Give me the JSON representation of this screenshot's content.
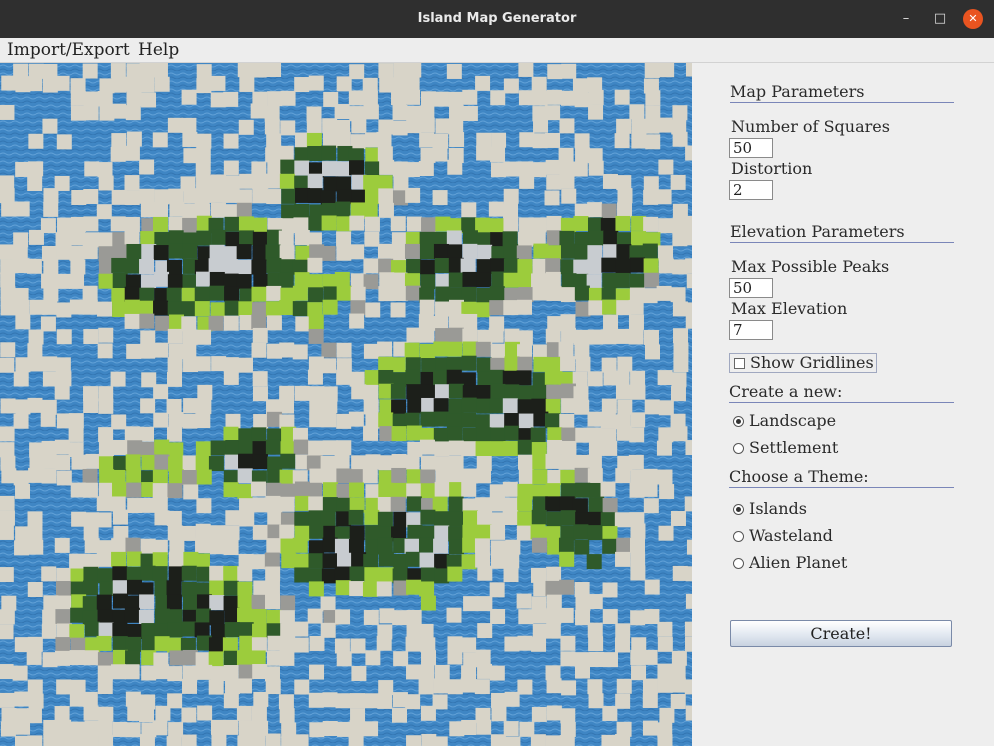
{
  "window": {
    "title": "Island Map Generator"
  },
  "menu": [
    "Import/Export",
    "Help"
  ],
  "map": {
    "water_color": "#3f86c4",
    "legend_colors": {
      "sand": "#d8d4c8",
      "rock": "#9a9a96",
      "grass": "#9ccc3c",
      "forest": "#2f5a2a",
      "peak": "#1c1f1a",
      "snow": "#c8ccd0"
    }
  },
  "panel": {
    "map_params_title": "Map Parameters",
    "squares_label": "Number of Squares",
    "squares_value": "50",
    "distortion_label": "Distortion",
    "distortion_value": "2",
    "elev_params_title": "Elevation Parameters",
    "peaks_label": "Max Possible Peaks",
    "peaks_value": "50",
    "max_elev_label": "Max Elevation",
    "max_elev_value": "7",
    "gridlines_label": "Show Gridlines",
    "gridlines_checked": false,
    "create_new_title": "Create a new:",
    "create_options": [
      {
        "label": "Landscape",
        "selected": true
      },
      {
        "label": "Settlement",
        "selected": false
      }
    ],
    "theme_title": "Choose a Theme:",
    "theme_options": [
      {
        "label": "Islands",
        "selected": true
      },
      {
        "label": "Wasteland",
        "selected": false
      },
      {
        "label": "Alien Planet",
        "selected": false
      }
    ],
    "create_button": "Create!"
  }
}
